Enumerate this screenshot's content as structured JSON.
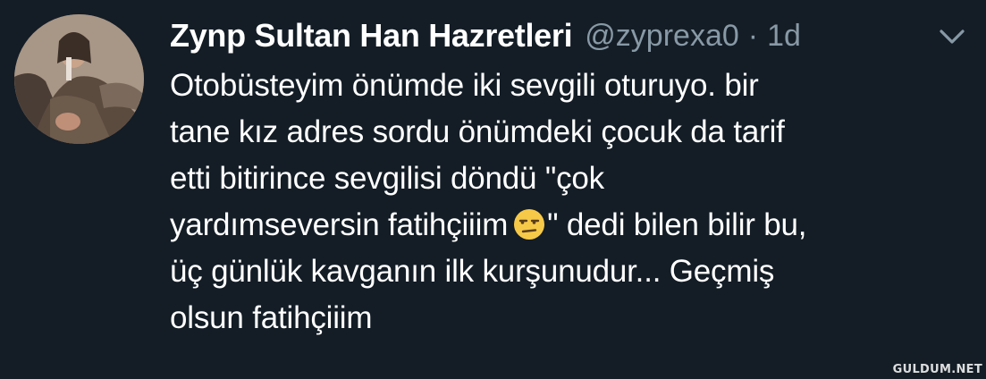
{
  "tweet": {
    "author": {
      "display_name": "Zynp Sultan Han Hazretleri",
      "handle": "@zyprexa0",
      "avatar_icon": "profile-photo"
    },
    "separator": "·",
    "timestamp": "1d",
    "menu_icon": "chevron-down-icon",
    "text_lines": {
      "l1": "Otobüsteyim önümde iki sevgili oturuyo. bir",
      "l2": "tane kız adres sordu önümdeki çocuk da tarif",
      "l3": "etti bitirince sevgilisi döndü \"çok",
      "l4a": "yardımseversin fatihçiiim",
      "l4b": "\" dedi bilen bilir bu,",
      "l5": "üç günlük kavganın ilk kurşunudur... Geçmiş",
      "l6": "olsun fatihçiiim"
    },
    "emoji": "unamused-face"
  },
  "watermark": "GULDUM.NET",
  "colors": {
    "background": "#141d26",
    "text_primary": "#ffffff",
    "text_secondary": "#8899a6",
    "emoji_fill": "#f7c948"
  }
}
